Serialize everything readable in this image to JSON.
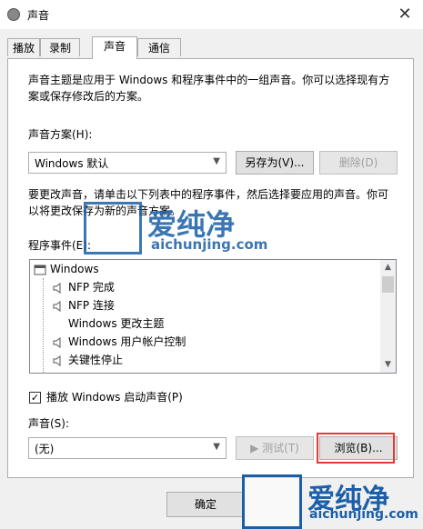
{
  "window": {
    "title": "声音",
    "close_glyph": "✕"
  },
  "tabs": [
    {
      "label": "播放"
    },
    {
      "label": "录制"
    },
    {
      "label": "声音"
    },
    {
      "label": "通信"
    }
  ],
  "panel": {
    "description": "声音主题是应用于 Windows 和程序事件中的一组声音。你可以选择现有方案或保存修改后的方案。",
    "scheme_label": "声音方案(H):",
    "scheme_value": "Windows 默认",
    "save_as_label": "另存为(V)...",
    "delete_label": "删除(D)",
    "instruction": "要更改声音，请单击以下列表中的程序事件，然后选择要应用的声音。你可以将更改保存为新的声音方案。",
    "events_label": "程序事件(E):",
    "events": [
      {
        "label": "Windows",
        "icon": "windows-icon"
      },
      {
        "label": "NFP 完成",
        "icon": "speaker-icon"
      },
      {
        "label": "NFP 连接",
        "icon": "speaker-icon"
      },
      {
        "label": "Windows 更改主题",
        "icon": "none"
      },
      {
        "label": "Windows 用户帐户控制",
        "icon": "speaker-icon"
      },
      {
        "label": "关键性停止",
        "icon": "speaker-icon"
      }
    ],
    "startup_checkbox_label": "播放 Windows 启动声音(P)",
    "startup_checked": true,
    "sound_label": "声音(S):",
    "sound_value": "(无)",
    "test_label": "▶ 测试(T)",
    "browse_label": "浏览(B)..."
  },
  "footer": {
    "ok_label": "确定"
  },
  "watermark": {
    "brand_cn": "爱纯净",
    "brand_url": "aichunjing.com"
  },
  "colors": {
    "highlight": "#e53935",
    "watermark": "#1a5fa8"
  }
}
